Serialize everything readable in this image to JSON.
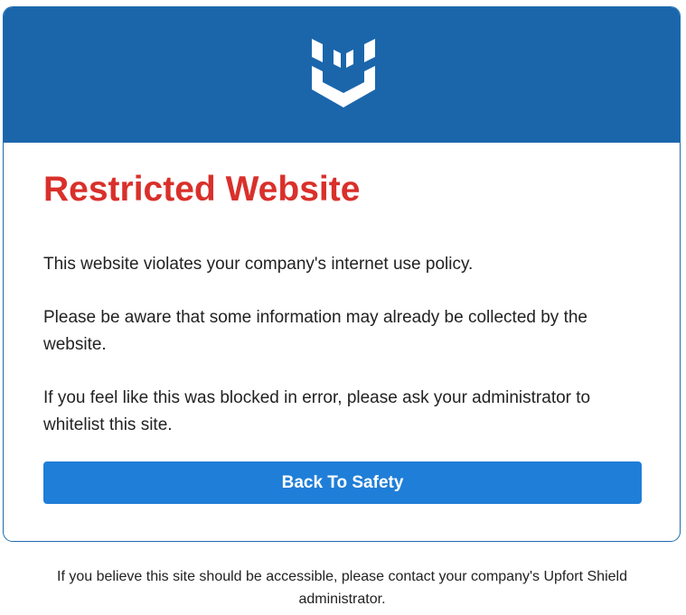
{
  "banner": {
    "color": "#1b66ab",
    "logo_icon": "upfort-shield-logo-icon"
  },
  "main": {
    "title": "Restricted Website",
    "title_color": "#d9302b",
    "paragraphs": [
      "This website violates your company's internet use policy.",
      "Please be aware that some information may already be collected by the website.",
      "If you feel like this was blocked in error, please ask your administrator to whitelist this site."
    ],
    "back_button_label": "Back To Safety",
    "button_color": "#1f7ed8"
  },
  "footer": {
    "text": "If you believe this site should be accessible, please contact your company's Upfort Shield administrator."
  }
}
